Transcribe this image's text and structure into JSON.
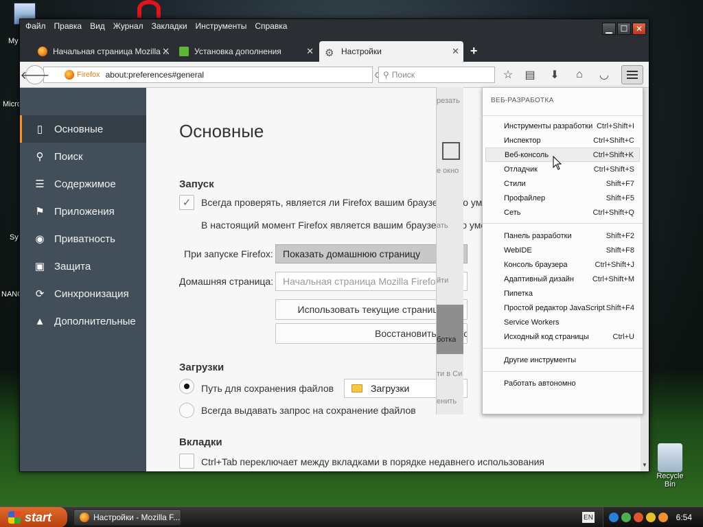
{
  "desktop": {
    "icons": [
      {
        "label": "My"
      },
      {
        "label": "Micro"
      },
      {
        "label": "Sy"
      },
      {
        "label": "NANO"
      },
      {
        "label": "Recycle Bin"
      }
    ]
  },
  "menubar": {
    "items": [
      "Файл",
      "Правка",
      "Вид",
      "Журнал",
      "Закладки",
      "Инструменты",
      "Справка"
    ]
  },
  "window_controls": {
    "minimize": "▁",
    "maximize": "☐",
    "close": "✕"
  },
  "tabs": [
    {
      "label": "Начальная страница Mozilla ...",
      "close": "✕"
    },
    {
      "label": "Установка дополнения",
      "close": "✕"
    },
    {
      "label": "Настройки",
      "close": "✕"
    }
  ],
  "newtab": "+",
  "navbar": {
    "back": "🡐",
    "identity": "Firefox",
    "url": "about:preferences#general",
    "reload": "⟳",
    "search_placeholder": "Поиск"
  },
  "sidebar": {
    "items": [
      {
        "label": "Основные",
        "icon": "▯"
      },
      {
        "label": "Поиск",
        "icon": "⚲"
      },
      {
        "label": "Содержимое",
        "icon": "☰"
      },
      {
        "label": "Приложения",
        "icon": "⚑"
      },
      {
        "label": "Приватность",
        "icon": "◉"
      },
      {
        "label": "Защита",
        "icon": "▣"
      },
      {
        "label": "Синхронизация",
        "icon": "⟳"
      },
      {
        "label": "Дополнительные",
        "icon": "▲"
      }
    ]
  },
  "main": {
    "title": "Основные",
    "startup": {
      "section": "Запуск",
      "always_check": "Всегда проверять, является ли Firefox вашим браузером по умолчанию",
      "current_default": "В настоящий момент Firefox является вашим браузером по умолчанию",
      "on_start_label": "При запуске Firefox:",
      "on_start_value": "Показать домашнюю страницу",
      "home_label": "Домашняя страница:",
      "home_placeholder": "Начальная страница Mozilla Firefox",
      "use_current": "Использовать текущие страницы",
      "restore": "Восстановить по умолчанию"
    },
    "downloads": {
      "section": "Загрузки",
      "save_to": "Путь для сохранения файлов",
      "folder": "Загрузки",
      "always_ask": "Всегда выдавать запрос на сохранение файлов"
    },
    "tabs_section": {
      "section": "Вкладки",
      "ctrl_tab": "Ctrl+Tab переключает между вкладками в порядке недавнего использования"
    }
  },
  "panel_peek": {
    "items": [
      "резать",
      "е окно",
      "ать",
      "йти",
      "ботка",
      "ти в Си",
      "енить"
    ]
  },
  "devmenu": {
    "header": "ВЕБ-РАЗРАБОТКА",
    "items": [
      {
        "label": "Инструменты разработки",
        "shortcut": "Ctrl+Shift+I"
      },
      {
        "label": "Инспектор",
        "shortcut": "Ctrl+Shift+C"
      },
      {
        "label": "Веб-консоль",
        "shortcut": "Ctrl+Shift+K"
      },
      {
        "label": "Отладчик",
        "shortcut": "Ctrl+Shift+S"
      },
      {
        "label": "Стили",
        "shortcut": "Shift+F7"
      },
      {
        "label": "Профайлер",
        "shortcut": "Shift+F5"
      },
      {
        "label": "Сеть",
        "shortcut": "Ctrl+Shift+Q"
      },
      {
        "label": "Панель разработки",
        "shortcut": "Shift+F2"
      },
      {
        "label": "WebIDE",
        "shortcut": "Shift+F8"
      },
      {
        "label": "Консоль браузера",
        "shortcut": "Ctrl+Shift+J"
      },
      {
        "label": "Адаптивный дизайн",
        "shortcut": "Ctrl+Shift+M"
      },
      {
        "label": "Пипетка",
        "shortcut": ""
      },
      {
        "label": "Простой редактор JavaScript",
        "shortcut": "Shift+F4"
      },
      {
        "label": "Service Workers",
        "shortcut": ""
      },
      {
        "label": "Исходный код страницы",
        "shortcut": "Ctrl+U"
      },
      {
        "label": "Другие инструменты",
        "shortcut": ""
      },
      {
        "label": "Работать автономно",
        "shortcut": ""
      }
    ]
  },
  "taskbar": {
    "start": "start",
    "task": "Настройки - Mozilla F...",
    "lang": "EN",
    "clock": "6:54"
  },
  "colors": {
    "sidebar_bg": "#424f5a",
    "accent": "#ff9500",
    "window_frame": "#2b2f33"
  }
}
